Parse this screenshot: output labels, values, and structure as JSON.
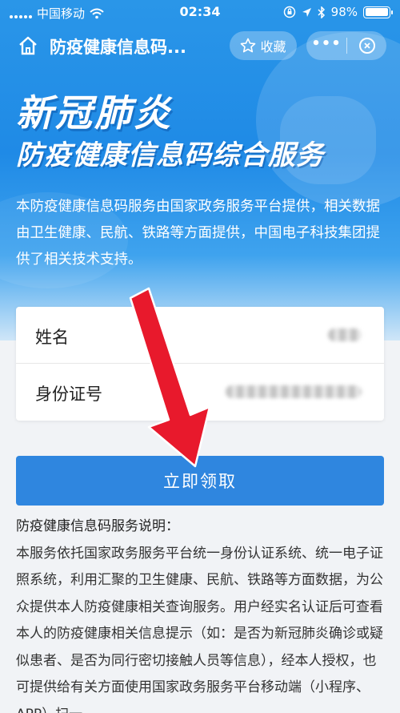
{
  "status_bar": {
    "carrier": "中国移动",
    "time": "02:34",
    "battery": "98%",
    "battery_level": 0.98
  },
  "nav": {
    "title": "防疫健康信息码...",
    "favorite_label": "收藏",
    "more_label": "•••",
    "icons": [
      "home-icon",
      "star-icon",
      "more-icon",
      "close-circle-icon"
    ]
  },
  "hero": {
    "headline": "新冠肺炎",
    "subheadline": "防疫健康信息码综合服务",
    "intro": "本防疫健康信息码服务由国家政务服务平台提供，相关数据由卫生健康、民航、铁路等方面提供，中国电子科技集团提供了相关技术支持。"
  },
  "form": {
    "name_label": "姓名",
    "id_label": "身份证号"
  },
  "submit_label": "立即领取",
  "notes": {
    "title": "防疫健康信息码服务说明：",
    "body": "本服务依托国家政务服务平台统一身份认证系统、统一电子证照系统，利用汇聚的卫生健康、民航、铁路等方面数据，为公众提供本人防疫健康相关查询服务。用户经实名认证后可查看本人的防疫健康相关信息提示（如：是否为新冠肺炎确诊或疑似患者、是否为同行密切接触人员等信息），经本人授权，也可提供给有关方面使用国家政务服务平台移动端（小程序、APP）扫一"
  },
  "colors": {
    "hero_blue": "#1f8ae6",
    "button_blue": "#2f86df",
    "arrow_red": "#e8192c"
  }
}
